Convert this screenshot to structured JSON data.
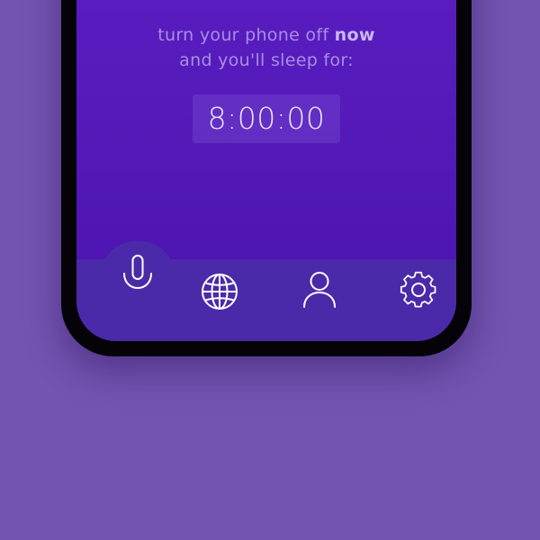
{
  "message": {
    "line1_prefix": "turn your phone off ",
    "line1_emphasis": "now",
    "line2": "and you'll sleep for:"
  },
  "timer": {
    "value": "8:00:00"
  },
  "tabbar": {
    "tabs": [
      {
        "icon": "microphone-icon",
        "active": true
      },
      {
        "icon": "globe-icon",
        "active": false
      },
      {
        "icon": "profile-icon",
        "active": false
      },
      {
        "icon": "gear-icon",
        "active": false
      }
    ]
  },
  "colors": {
    "background": "#7354b0",
    "screen": "#5219b7",
    "tabbar": "#4b2aa9",
    "icon": "#ffffff"
  }
}
